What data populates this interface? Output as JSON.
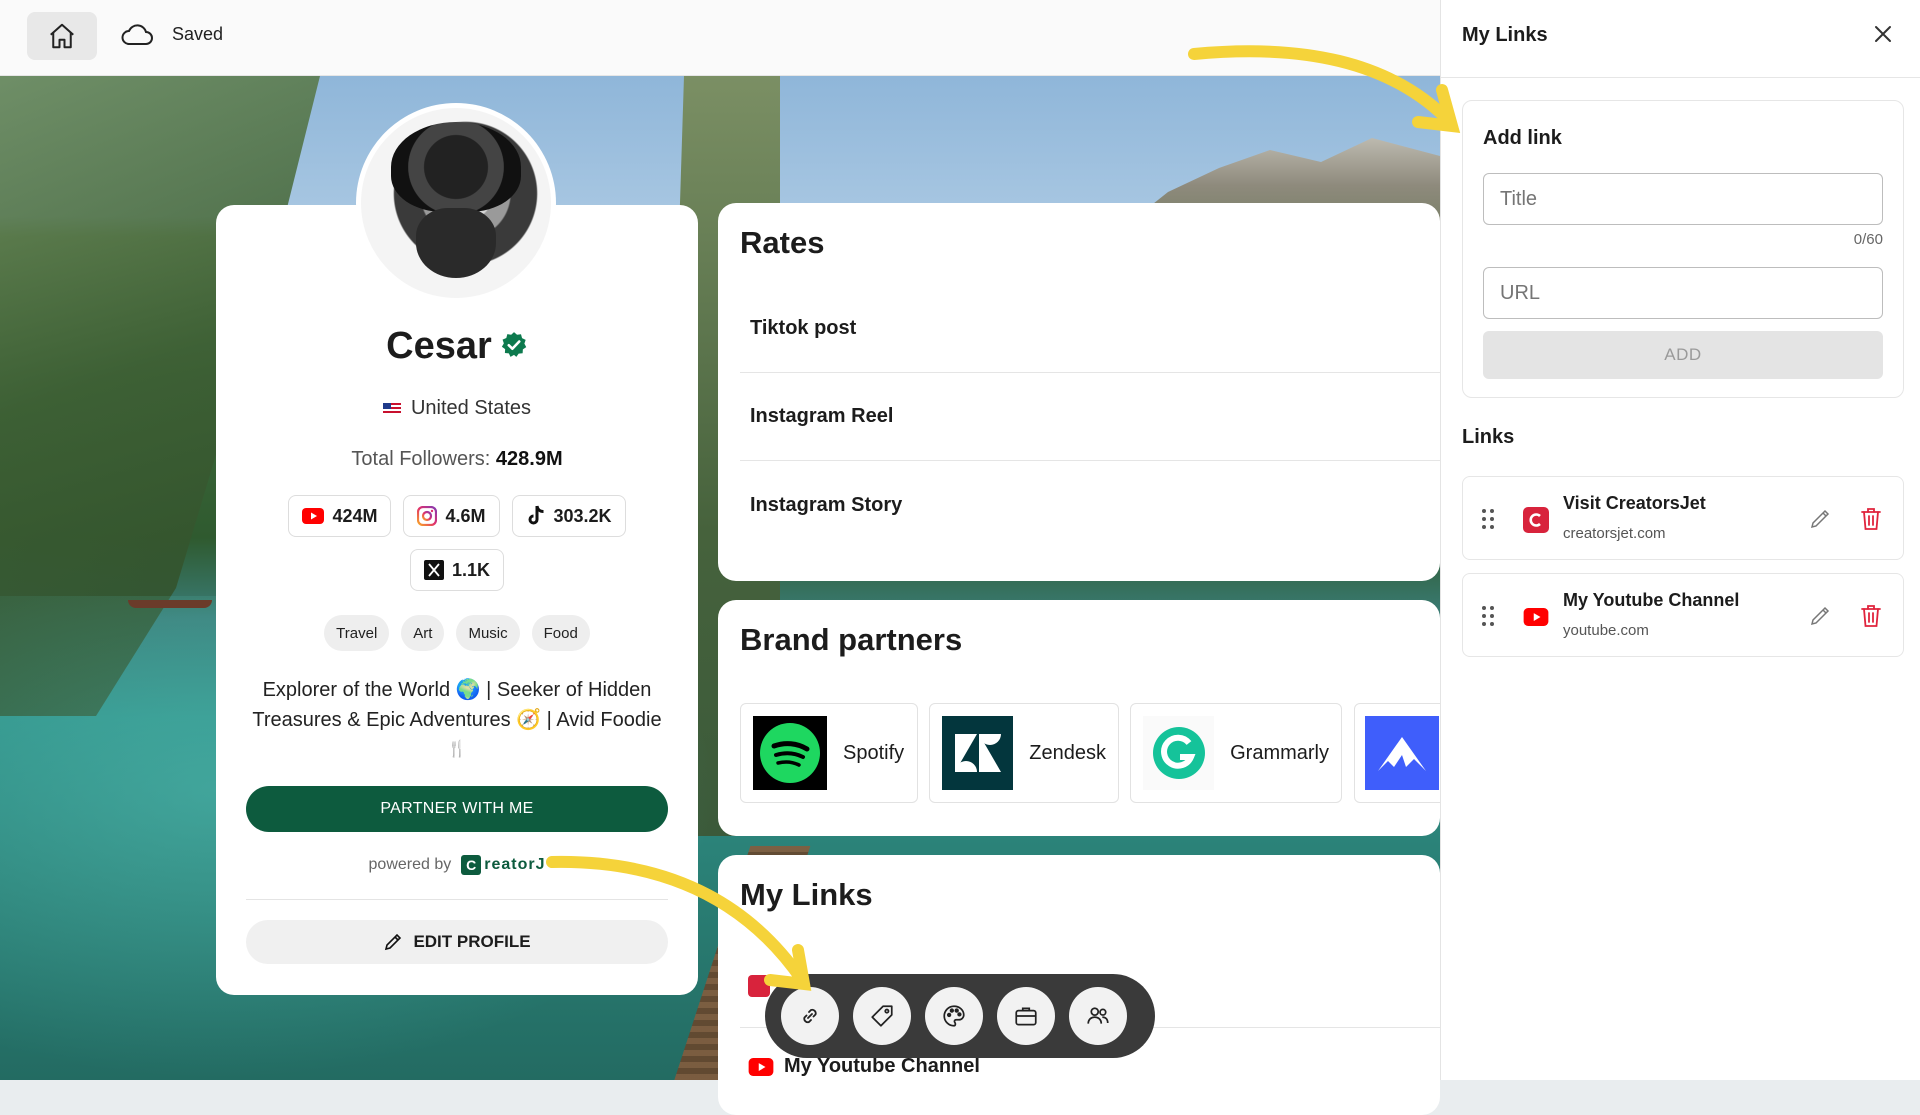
{
  "topbar": {
    "home_icon": "home-icon",
    "cloud_icon": "cloud-icon",
    "saved_label": "Saved"
  },
  "profile": {
    "name": "Cesar",
    "country": "United States",
    "followers_label": "Total Followers:",
    "followers_value": "428.9M",
    "socials": [
      {
        "icon": "youtube-icon",
        "value": "424M"
      },
      {
        "icon": "instagram-icon",
        "value": "4.6M"
      },
      {
        "icon": "tiktok-icon",
        "value": "303.2K"
      },
      {
        "icon": "x-icon",
        "value": "1.1K"
      }
    ],
    "tags": [
      "Travel",
      "Art",
      "Music",
      "Food"
    ],
    "bio_line1": "Explorer of the World 🌍 | Seeker of Hidden",
    "bio_line2": "Treasures & Epic Adventures 🧭 | Avid Foodie",
    "bio_line3": "🍴",
    "partner_button": "PARTNER WITH ME",
    "powered_by": "powered by",
    "powered_brand": "reatorJ",
    "edit_button": "EDIT PROFILE"
  },
  "rates": {
    "title": "Rates",
    "items": [
      "Tiktok post",
      "Instagram Reel",
      "Instagram Story"
    ]
  },
  "brand_partners": {
    "title": "Brand partners",
    "items": [
      "Spotify",
      "Zendesk",
      "Grammarly"
    ]
  },
  "my_links_section": {
    "title": "My Links",
    "partial_item": "My Youtube Channel"
  },
  "toolbar": {
    "tools": [
      "link-icon",
      "tag-icon",
      "palette-icon",
      "briefcase-icon",
      "users-icon"
    ]
  },
  "side_panel": {
    "title": "My Links",
    "add_link": {
      "title": "Add link",
      "title_placeholder": "Title",
      "title_count": "0/60",
      "url_placeholder": "URL",
      "add_button": "ADD"
    },
    "links_title": "Links",
    "links": [
      {
        "name": "Visit CreatorsJet",
        "url": "creatorsjet.com",
        "icon": "creatorsjet-logo-icon"
      },
      {
        "name": "My Youtube Channel",
        "url": "youtube.com",
        "icon": "youtube-icon"
      }
    ]
  },
  "colors": {
    "brand_green": "#0d5b3e",
    "danger_red": "#d8233c",
    "arrow_yellow": "#f5d33a"
  }
}
